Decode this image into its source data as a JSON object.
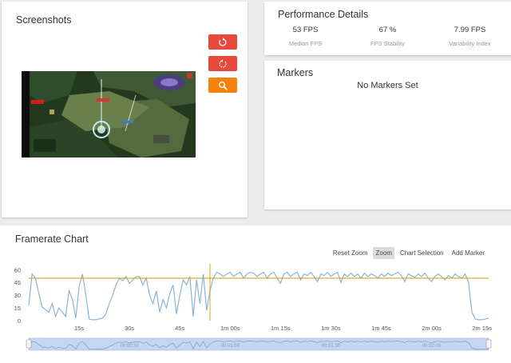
{
  "screenshots": {
    "title": "Screenshots",
    "buttons": [
      {
        "name": "rotate-ccw",
        "icon": "rotate-ccw-icon"
      },
      {
        "name": "rotate-cw",
        "icon": "rotate-cw-icon"
      },
      {
        "name": "zoom",
        "icon": "magnifier-icon"
      }
    ]
  },
  "performance": {
    "title": "Performance Details",
    "stats": [
      {
        "value": "53 FPS",
        "label": "Median FPS"
      },
      {
        "value": "67 %",
        "label": "FPS Stability"
      },
      {
        "value": "7.99 FPS",
        "label": "Variability Index"
      }
    ]
  },
  "markers": {
    "title": "Markers",
    "empty_text": "No Markers Set"
  },
  "chart": {
    "title": "Framerate Chart",
    "tools": [
      "Reset Zoom",
      "Zoom",
      "Chart Selection",
      "Add Marker"
    ],
    "active_tool": "Zoom"
  },
  "colors": {
    "red_button": "#e74a3b",
    "orange_button": "#f5820b",
    "series_line": "#8ab4d6",
    "median_line": "#d9a020",
    "navigator_fill": "#c5d6ee"
  },
  "chart_data": {
    "type": "line",
    "title": "",
    "xlabel": "",
    "ylabel": "",
    "ylim": [
      0,
      65
    ],
    "xlim_seconds": [
      0,
      137
    ],
    "yticks": [
      0,
      15,
      30,
      45,
      60
    ],
    "xticks": [
      {
        "t": 15,
        "label": "15s"
      },
      {
        "t": 30,
        "label": "30s"
      },
      {
        "t": 45,
        "label": "45s"
      },
      {
        "t": 60,
        "label": "1m 00s"
      },
      {
        "t": 75,
        "label": "1m 15s"
      },
      {
        "t": 90,
        "label": "1m 30s"
      },
      {
        "t": 105,
        "label": "1m 45s"
      },
      {
        "t": 120,
        "label": "2m 00s"
      },
      {
        "t": 135,
        "label": "2m 15s"
      }
    ],
    "median_fps": 50,
    "cursor_time": 54,
    "series": [
      {
        "x": [
          0,
          1,
          2,
          3,
          4,
          5,
          6,
          7,
          8,
          9,
          10,
          11,
          12,
          13,
          14,
          15,
          16,
          17,
          18,
          19,
          20,
          21,
          22,
          23,
          24,
          25,
          26,
          27,
          28,
          29,
          30,
          31,
          32,
          33,
          34,
          35,
          36,
          37,
          38,
          39,
          40,
          41,
          42,
          43,
          44,
          45,
          46,
          47,
          48,
          49,
          50,
          51,
          52,
          53,
          54,
          55,
          56,
          57,
          58,
          59,
          60,
          61,
          62,
          63,
          64,
          65,
          66,
          67,
          68,
          69,
          70,
          71,
          72,
          73,
          74,
          75,
          76,
          77,
          78,
          79,
          80,
          81,
          82,
          83,
          84,
          85,
          86,
          87,
          88,
          89,
          90,
          91,
          92,
          93,
          94,
          95,
          96,
          97,
          98,
          99,
          100,
          101,
          102,
          103,
          104,
          105,
          106,
          107,
          108,
          109,
          110,
          111,
          112,
          113,
          114,
          115,
          116,
          117,
          118,
          119,
          120,
          121,
          122,
          123,
          124,
          125,
          126,
          127,
          128,
          129,
          130,
          131,
          132,
          133,
          134,
          135,
          136,
          137
        ],
        "values": [
          18,
          55,
          50,
          32,
          16,
          13,
          10,
          20,
          5,
          15,
          10,
          5,
          35,
          25,
          3,
          40,
          55,
          30,
          2,
          1,
          1,
          2,
          3,
          8,
          20,
          30,
          42,
          50,
          47,
          52,
          44,
          48,
          52,
          52,
          42,
          50,
          30,
          20,
          35,
          10,
          25,
          15,
          32,
          42,
          8,
          30,
          48,
          42,
          52,
          5,
          48,
          20,
          55,
          12,
          35,
          50,
          57,
          55,
          52,
          55,
          57,
          52,
          55,
          57,
          50,
          55,
          57,
          56,
          52,
          55,
          57,
          50,
          55,
          57,
          50,
          44,
          55,
          57,
          52,
          55,
          57,
          48,
          55,
          53,
          57,
          52,
          46,
          55,
          53,
          57,
          52,
          55,
          57,
          45,
          55,
          52,
          56,
          52,
          55,
          50,
          56,
          52,
          55,
          53,
          50,
          55,
          52,
          56,
          53,
          55,
          57,
          53,
          46,
          55,
          53,
          51,
          55,
          52,
          56,
          50,
          46,
          52,
          55,
          52,
          48,
          53,
          50,
          55,
          52,
          50,
          55,
          45,
          10,
          2,
          1,
          1,
          2,
          3
        ]
      }
    ],
    "navigator_ticks": [
      "00:00:30",
      "00:01:00",
      "00:01:30",
      "00:02:00"
    ]
  }
}
